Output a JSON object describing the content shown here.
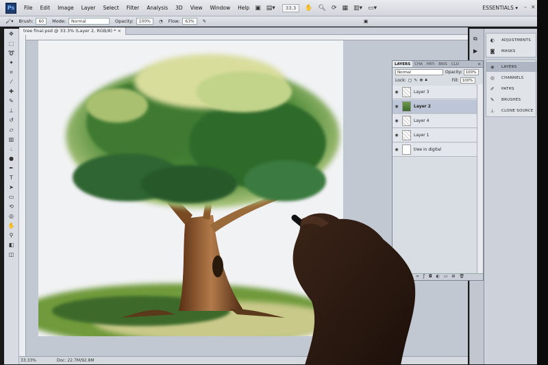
{
  "menubar": {
    "logo": "Ps",
    "items": [
      "File",
      "Edit",
      "Image",
      "Layer",
      "Select",
      "Filter",
      "Analysis",
      "3D",
      "View",
      "Window",
      "Help"
    ],
    "zoom": "33.3",
    "workspace": "ESSENTIALS"
  },
  "options": {
    "brush_label": "Brush:",
    "brush_size": "60",
    "mode_label": "Mode:",
    "mode_value": "Normal",
    "opacity_label": "Opacity:",
    "opacity_value": "100%",
    "flow_label": "Flow:",
    "flow_value": "63%"
  },
  "document": {
    "tab_title": "tree final.psd @ 33.3% (Layer 2, RGB/8) *",
    "zoom_status": "33.33%",
    "doc_info": "Doc: 22.7M/92.8M"
  },
  "layers_panel": {
    "tabs": [
      "LAYERS",
      "CHA",
      "PATI",
      "BRIS",
      "CLO"
    ],
    "blend_mode": "Normal",
    "opacity_label": "Opacity:",
    "opacity_value": "100%",
    "lock_label": "Lock:",
    "fill_label": "Fill:",
    "fill_value": "100%",
    "layers": [
      {
        "name": "Layer 3",
        "selected": false,
        "thumb": "transparent"
      },
      {
        "name": "Layer 2",
        "selected": true,
        "thumb": "image"
      },
      {
        "name": "Layer 4",
        "selected": false,
        "thumb": "transparent"
      },
      {
        "name": "Layer 1",
        "selected": false,
        "thumb": "transparent"
      },
      {
        "name": "tree in digital",
        "selected": false,
        "thumb": "white"
      }
    ]
  },
  "dock": {
    "group1": [
      "ADJUSTMENTS",
      "MASKS"
    ],
    "group2": [
      "LAYERS",
      "CHANNELS",
      "PATHS",
      "BRUSHES",
      "CLONE SOURCE"
    ],
    "active": "LAYERS"
  }
}
